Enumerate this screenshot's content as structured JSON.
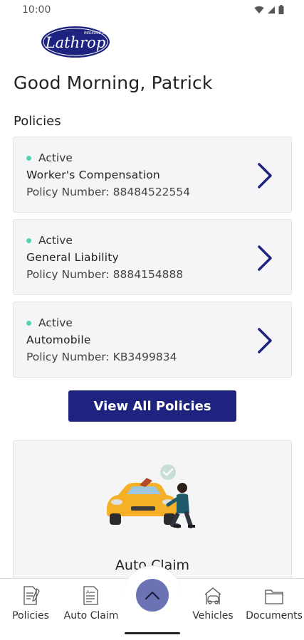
{
  "status_bar": {
    "time": "10:00"
  },
  "logo": {
    "brand": "Lathrop",
    "tagline": "INSURANCE"
  },
  "greeting": "Good Morning, Patrick",
  "policies_section": {
    "title": "Policies",
    "items": [
      {
        "status": "Active",
        "name": "Worker's Compensation",
        "number": "Policy Number: 88484522554"
      },
      {
        "status": "Active",
        "name": "General Liability",
        "number": "Policy Number: 8884154888"
      },
      {
        "status": "Active",
        "name": "Automobile",
        "number": "Policy Number: KB3499834"
      }
    ],
    "view_all_label": "View All Policies"
  },
  "auto_claim_card": {
    "label": "Auto Claim"
  },
  "bottom_nav": {
    "items": [
      {
        "label": "Policies",
        "icon": "policies-doc-icon"
      },
      {
        "label": "Auto Claim",
        "icon": "auto-claim-doc-icon"
      },
      {
        "label": "Vehicles",
        "icon": "vehicle-icon"
      },
      {
        "label": "Documents",
        "icon": "folder-icon"
      }
    ],
    "fab_icon": "chevron-up-icon"
  },
  "colors": {
    "primary": "#1e2380",
    "active_dot": "#52d4b4",
    "fab": "#6b73b5",
    "card_bg": "#f5f5f7"
  }
}
